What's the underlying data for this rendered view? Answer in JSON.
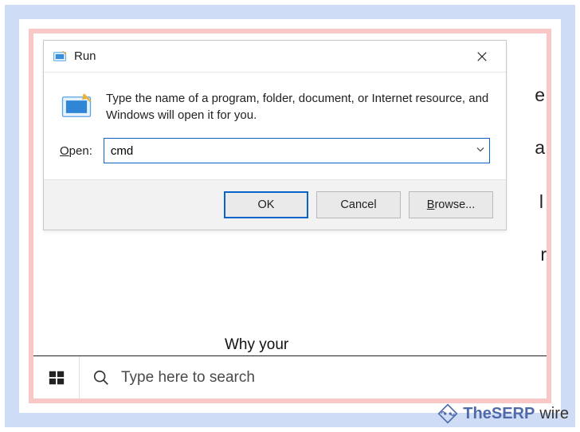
{
  "dialog": {
    "title": "Run",
    "instruction": "Type the name of a program, folder, document, or Internet resource, and Windows will open it for you.",
    "open_label": "Open:",
    "input_value": "cmd",
    "buttons": {
      "ok": "OK",
      "cancel": "Cancel",
      "browse": "Browse..."
    }
  },
  "taskbar": {
    "search_placeholder": "Type here to search"
  },
  "background": {
    "peek_title_fragment": "Why your",
    "letters": {
      "a": "e",
      "b": "a",
      "c": "l",
      "d": "r"
    }
  },
  "watermark": {
    "brand1": "TheSERP",
    "brand2": "wire"
  }
}
